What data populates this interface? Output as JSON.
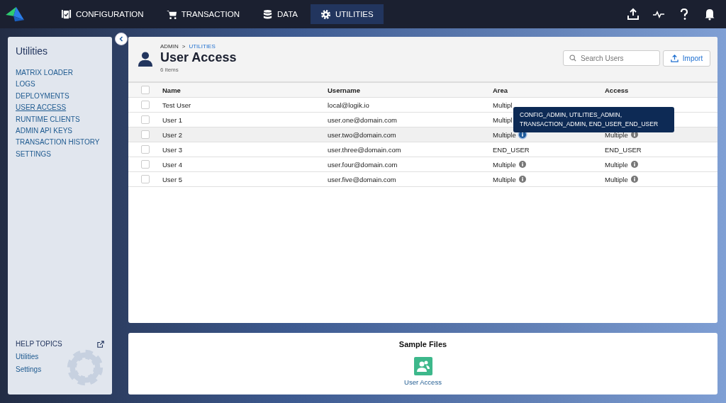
{
  "nav": {
    "tabs": [
      {
        "label": "CONFIGURATION",
        "selected": false
      },
      {
        "label": "TRANSACTION",
        "selected": false
      },
      {
        "label": "DATA",
        "selected": false
      },
      {
        "label": "UTILITIES",
        "selected": true
      }
    ]
  },
  "sidebar": {
    "title": "Utilities",
    "items": [
      {
        "label": "MATRIX LOADER",
        "selected": false
      },
      {
        "label": "LOGS",
        "selected": false
      },
      {
        "label": "DEPLOYMENTS",
        "selected": false
      },
      {
        "label": "USER ACCESS",
        "selected": true
      },
      {
        "label": "RUNTIME CLIENTS",
        "selected": false
      },
      {
        "label": "ADMIN API KEYS",
        "selected": false
      },
      {
        "label": "TRANSACTION HISTORY",
        "selected": false
      },
      {
        "label": "SETTINGS",
        "selected": false
      }
    ],
    "help": {
      "title": "HELP TOPICS",
      "links": [
        "Utilities",
        "Settings"
      ]
    }
  },
  "header": {
    "breadcrumb": [
      "ADMIN",
      "UTILITIES"
    ],
    "breadcrumb_separator": ">",
    "title": "User Access",
    "count": "6 items",
    "search": {
      "placeholder": "Search Users"
    },
    "import_button": "Import"
  },
  "table": {
    "columns": [
      "Name",
      "Username",
      "Area",
      "Access"
    ],
    "select_all_checked": false,
    "rows": [
      {
        "checked": false,
        "name": "Test User",
        "username": "local@logik.io",
        "area": "Multipl"
      },
      {
        "checked": false,
        "name": "User 1",
        "username": "user.one@domain.com",
        "area": "Multipl"
      },
      {
        "checked": false,
        "name": "User 2",
        "username": "user.two@domain.com",
        "area": "Multiple",
        "area_info": true,
        "area_info_active": true,
        "access": "Multiple",
        "access_info": true,
        "hovered": true
      },
      {
        "checked": false,
        "name": "User 3",
        "username": "user.three@domain.com",
        "area": "END_USER",
        "area_info": false,
        "access": "END_USER",
        "access_info": false
      },
      {
        "checked": false,
        "name": "User 4",
        "username": "user.four@domain.com",
        "area": "Multiple",
        "area_info": true,
        "area_info_active": false,
        "access": "Multiple",
        "access_info": true
      },
      {
        "checked": false,
        "name": "User 5",
        "username": "user.five@domain.com",
        "area": "Multiple",
        "area_info": true,
        "area_info_active": false,
        "access": "Multiple",
        "access_info": true
      }
    ],
    "tooltip": [
      "CONFIG_ADMIN, UTILITIES_ADMIN,",
      "TRANSACTION_ADMIN, END_USER_END_USER"
    ]
  },
  "sample_files": {
    "title": "Sample Files",
    "file": "User Access"
  }
}
